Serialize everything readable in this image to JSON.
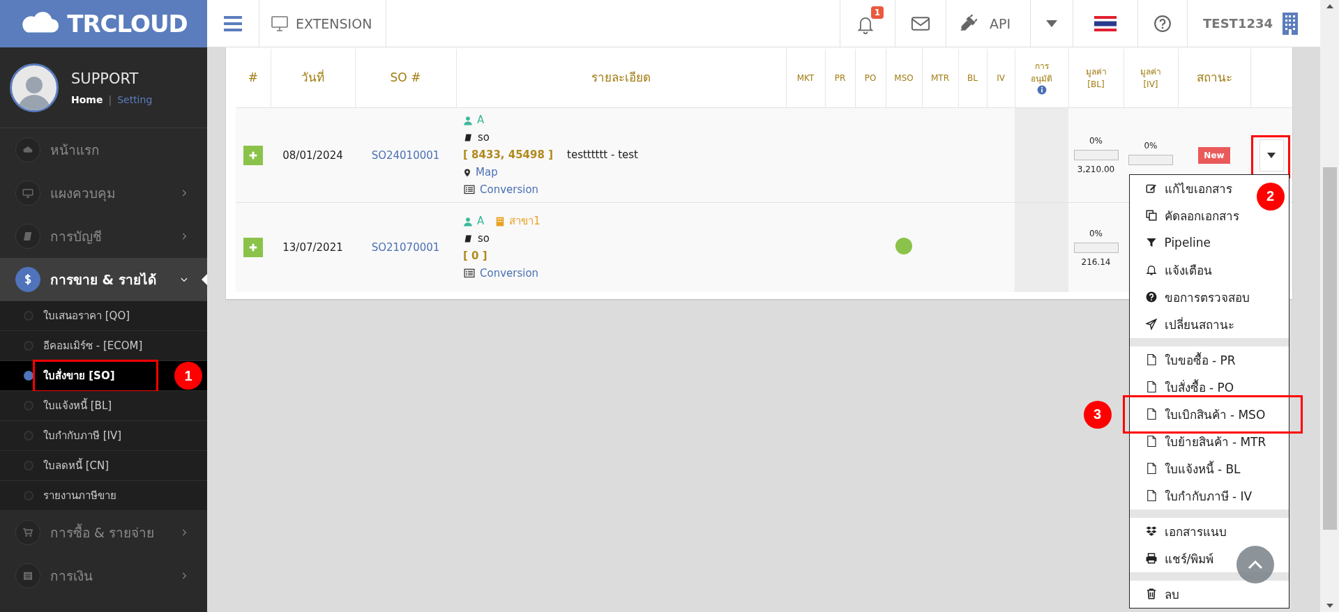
{
  "topbar": {
    "logo": "TRCLOUD",
    "extension": "EXTENSION",
    "notifications": "1",
    "api": "API",
    "user": "TEST1234"
  },
  "sidebar": {
    "profile": {
      "name": "SUPPORT",
      "home": "Home",
      "separator": "|",
      "setting": "Setting"
    },
    "items": [
      {
        "label": "หน้าแรก",
        "kind": "link"
      },
      {
        "label": "แผงควบคุม",
        "kind": "group",
        "expanded": false
      },
      {
        "label": "การบัญชี",
        "kind": "group",
        "expanded": false
      },
      {
        "label": "การขาย & รายได้",
        "kind": "group",
        "expanded": true,
        "children": [
          {
            "label": "ใบเสนอราคา [QO]",
            "selected": false
          },
          {
            "label": "อีคอมเมิร์ซ - [ECOM]",
            "selected": false
          },
          {
            "label": "ใบสั่งขาย [SO]",
            "selected": true,
            "annotation": "1"
          },
          {
            "label": "ใบแจ้งหนี้ [BL]",
            "selected": false
          },
          {
            "label": "ใบกำกับภาษี [IV]",
            "selected": false
          },
          {
            "label": "ใบลดหนี้ [CN]",
            "selected": false
          },
          {
            "label": "รายงานภาษีขาย",
            "selected": false
          }
        ]
      },
      {
        "label": "การซื้อ & รายจ่าย",
        "kind": "group",
        "expanded": false
      },
      {
        "label": "การเงิน",
        "kind": "group",
        "expanded": false
      }
    ]
  },
  "table": {
    "columns": [
      "#",
      "วันที่",
      "SO #",
      "รายละเอียด",
      "MKT",
      "PR",
      "PO",
      "MSO",
      "MTR",
      "BL",
      "IV",
      "การ อนุมัติ",
      "มูลค่า [BL]",
      "มูลค่า [IV]",
      "สถานะ"
    ],
    "rows": [
      {
        "date": "08/01/2024",
        "so": "SO24010001",
        "customer": "A",
        "doc": "so",
        "codes": "[ 8433, 45498 ]",
        "note": "testttttt - test",
        "map": "Map",
        "conversion": "Conversion",
        "mso_done": false,
        "bl": {
          "pct": "0%",
          "level": 0,
          "amount": "3,210.00"
        },
        "iv": {
          "pct": "0%",
          "level": 0
        },
        "status": "New",
        "menu_open": true
      },
      {
        "date": "13/07/2021",
        "so": "SO21070001",
        "customer": "A",
        "branch": "สาขา1",
        "doc": "so",
        "codes": "[ 0 ]",
        "conversion": "Conversion",
        "mso_done": true,
        "bl": {
          "pct": "0%",
          "level": 0,
          "amount": "216.14"
        },
        "menu_open": false
      }
    ]
  },
  "row_menu": {
    "toggle_annotation": "2",
    "groups": [
      [
        {
          "label": "แก้ไขเอกสาร"
        },
        {
          "label": "คัดลอกเอกสาร"
        },
        {
          "label": "Pipeline"
        },
        {
          "label": "แจ้งเตือน"
        },
        {
          "label": "ขอการตรวจสอบ"
        },
        {
          "label": "เปลี่ยนสถานะ"
        }
      ],
      [
        {
          "label": "ใบขอซื้อ - PR"
        },
        {
          "label": "ใบสั่งซื้อ - PO"
        },
        {
          "label": "ใบเบิกสินค้า - MSO",
          "annotation": "3"
        },
        {
          "label": "ใบย้ายสินค้า - MTR"
        },
        {
          "label": "ใบแจ้งหนี้ - BL"
        },
        {
          "label": "ใบกำกับภาษี - IV"
        }
      ],
      [
        {
          "label": "เอกสารแนบ"
        },
        {
          "label": "แชร์/พิมพ์"
        }
      ],
      [
        {
          "label": "ลบ"
        }
      ]
    ]
  }
}
